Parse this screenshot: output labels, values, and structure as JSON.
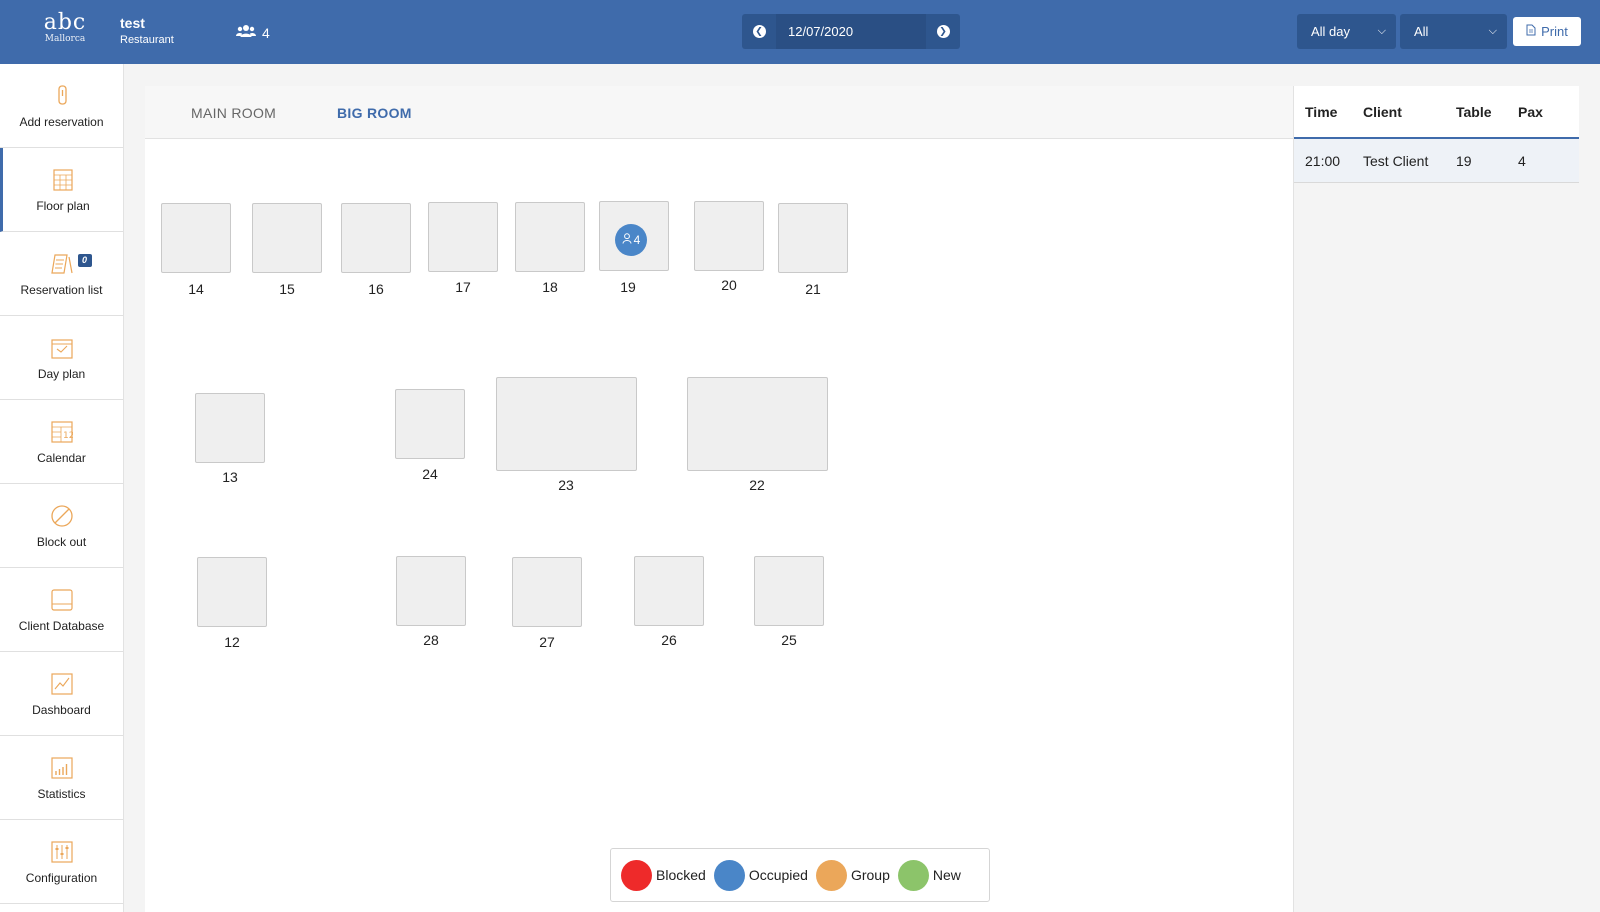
{
  "header": {
    "logo_top": "abc",
    "logo_bottom": "Mallorca",
    "restaurant_name": "test",
    "restaurant_type": "Restaurant",
    "guest_count": "4",
    "date": "12/07/2020",
    "shift_select": "All day",
    "room_select": "All",
    "print_label": "Print",
    "accent_color": "#3f6bab"
  },
  "sidebar": {
    "items": [
      {
        "label": "Add reservation",
        "icon": "add-reservation-icon"
      },
      {
        "label": "Floor plan",
        "icon": "floor-plan-icon"
      },
      {
        "label": "Reservation list",
        "icon": "reservation-list-icon",
        "badge": "0"
      },
      {
        "label": "Day plan",
        "icon": "day-plan-icon"
      },
      {
        "label": "Calendar",
        "icon": "calendar-icon"
      },
      {
        "label": "Block out",
        "icon": "block-out-icon"
      },
      {
        "label": "Client Database",
        "icon": "client-database-icon"
      },
      {
        "label": "Dashboard",
        "icon": "dashboard-icon"
      },
      {
        "label": "Statistics",
        "icon": "statistics-icon"
      },
      {
        "label": "Configuration",
        "icon": "configuration-icon"
      }
    ]
  },
  "rooms": {
    "tabs": [
      "MAIN ROOM",
      "BIG ROOM"
    ],
    "active": "BIG ROOM"
  },
  "tables": {
    "t14": "14",
    "t15": "15",
    "t16": "16",
    "t17": "17",
    "t18": "18",
    "t19": "19",
    "t20": "20",
    "t21": "21",
    "t13": "13",
    "t24": "24",
    "t23": "23",
    "t22": "22",
    "t12": "12",
    "t28": "28",
    "t27": "27",
    "t26": "26",
    "t25": "25",
    "occupied_pax": "4"
  },
  "legend": [
    {
      "label": "Blocked",
      "color": "#ee2a2a"
    },
    {
      "label": "Occupied",
      "color": "#4a86c8"
    },
    {
      "label": "Group",
      "color": "#eba75a"
    },
    {
      "label": "New",
      "color": "#8cc46a"
    }
  ],
  "reservations": {
    "columns": [
      "Time",
      "Client",
      "Table",
      "Pax"
    ],
    "rows": [
      {
        "time": "21:00",
        "client": "Test Client",
        "table": "19",
        "pax": "4"
      }
    ]
  }
}
